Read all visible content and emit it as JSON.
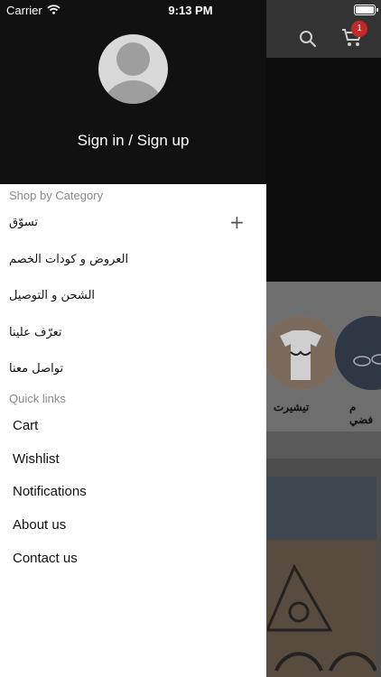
{
  "status_bar": {
    "carrier": "Carrier",
    "time": "9:13 PM"
  },
  "background": {
    "cart_badge": "1",
    "categories": [
      {
        "label": "تيشيرت"
      },
      {
        "label": "م فضي"
      }
    ]
  },
  "drawer": {
    "sign_in_label": "Sign in / Sign up",
    "shop_by_category_title": "Shop by Category",
    "categories": [
      {
        "label": "تسوّق",
        "expand": "+"
      },
      {
        "label": "العروض و كودات الخصم"
      },
      {
        "label": "الشحن و التوصيل"
      },
      {
        "label": "تعرّف علينا"
      },
      {
        "label": "تواصل معنا"
      }
    ],
    "quick_links_title": "Quick links",
    "quick_links": [
      {
        "label": "Cart"
      },
      {
        "label": "Wishlist"
      },
      {
        "label": "Notifications"
      },
      {
        "label": "About us"
      },
      {
        "label": "Contact us"
      }
    ]
  },
  "colors": {
    "drawer_header": "#111111",
    "badge": "#c62828",
    "section_title": "#8a8a8a"
  }
}
